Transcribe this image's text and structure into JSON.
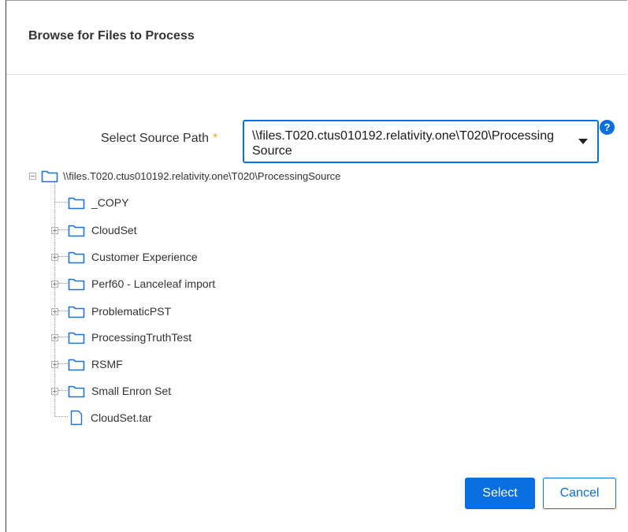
{
  "dialog": {
    "title": "Browse for Files to Process"
  },
  "source_path": {
    "label": "Select Source Path",
    "required_marker": "*",
    "value": "\\\\files.T020.ctus010192.relativity.one\\T020\\ProcessingSource",
    "help": "?"
  },
  "tree": {
    "root": {
      "label": "\\\\files.T020.ctus010192.relativity.one\\T020\\ProcessingSource",
      "expanded": true
    },
    "items": [
      {
        "label": "_COPY",
        "type": "folder",
        "expandable": false
      },
      {
        "label": "CloudSet",
        "type": "folder",
        "expandable": true
      },
      {
        "label": "Customer Experience",
        "type": "folder",
        "expandable": true
      },
      {
        "label": "Perf60 - Lanceleaf import",
        "type": "folder",
        "expandable": true
      },
      {
        "label": "ProblematicPST",
        "type": "folder",
        "expandable": true
      },
      {
        "label": "ProcessingTruthTest",
        "type": "folder",
        "expandable": true
      },
      {
        "label": "RSMF",
        "type": "folder",
        "expandable": true
      },
      {
        "label": "Small Enron Set",
        "type": "folder",
        "expandable": true
      },
      {
        "label": "CloudSet.tar",
        "type": "file",
        "expandable": false
      }
    ]
  },
  "buttons": {
    "select": "Select",
    "cancel": "Cancel"
  },
  "colors": {
    "accent": "#0a6fe0",
    "required": "#f5a623",
    "folder_icon": "#1a73d9"
  },
  "icons": {
    "folder": "folder-icon",
    "file": "file-icon",
    "help": "help-icon",
    "dropdown": "caret-down-icon",
    "expand": "plus-box-icon",
    "collapse": "minus-box-icon"
  }
}
